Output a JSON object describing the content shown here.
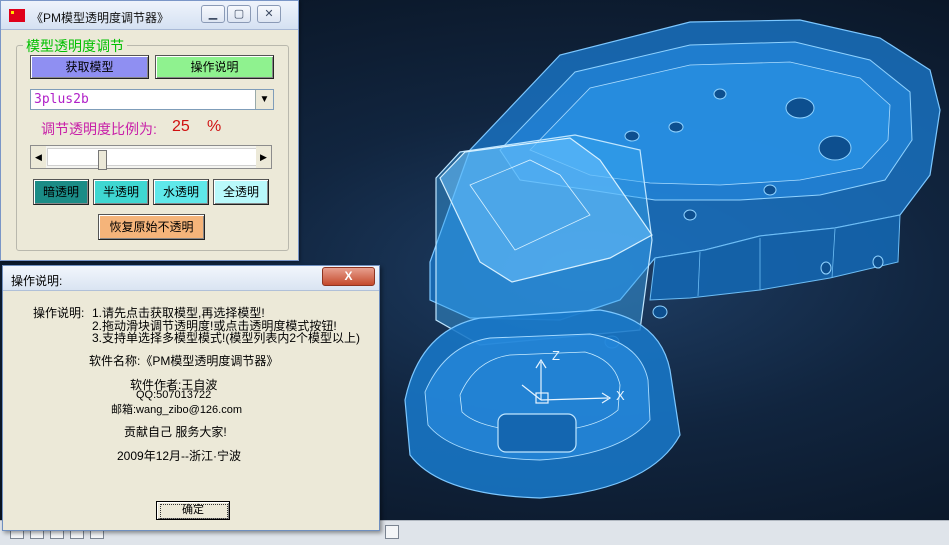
{
  "tool_window": {
    "title": "《PM模型透明度调节器》",
    "group_title": "模型透明度调节",
    "get_model_button": "获取模型",
    "help_button": "操作说明",
    "model_select": {
      "value": "3plus2b"
    },
    "ratio_label": "调节透明度比例为:",
    "ratio_value": "25",
    "ratio_unit": "%",
    "slider_level_percent": 25,
    "mode_buttons": [
      "暗透明",
      "半透明",
      "水透明",
      "全透明"
    ],
    "restore_button": "恢复原始不透明",
    "colors": {
      "get_model": "#8f8ff2",
      "help": "#8ff28f",
      "dark": "#1b8c86",
      "semi": "#3fd7d1",
      "water": "#5fe8ea",
      "full": "#b9f9fb",
      "restore": "#f5b47a"
    }
  },
  "dialog": {
    "title": "操作说明:",
    "close_label": "X",
    "instructions_label": "操作说明:",
    "steps": [
      "1.请先点击获取模型,再选择模型!",
      "2.拖动滑块调节透明度!或点击透明度模式按钮!",
      "3.支持单选择多模型模式!(模型列表内2个模型以上)"
    ],
    "software_name": "软件名称:《PM模型透明度调节器》",
    "author": "软件作者:王自波",
    "qq": "QQ:507013722",
    "email": "邮箱:wang_zibo@126.com",
    "motto": "贡献自己 服务大家!",
    "date_place": "2009年12月--浙江·宁波",
    "ok_button": "确定"
  },
  "viewport": {
    "axis_labels": {
      "z": "Z",
      "x": "X"
    },
    "model_color": "#1e7fd0"
  }
}
